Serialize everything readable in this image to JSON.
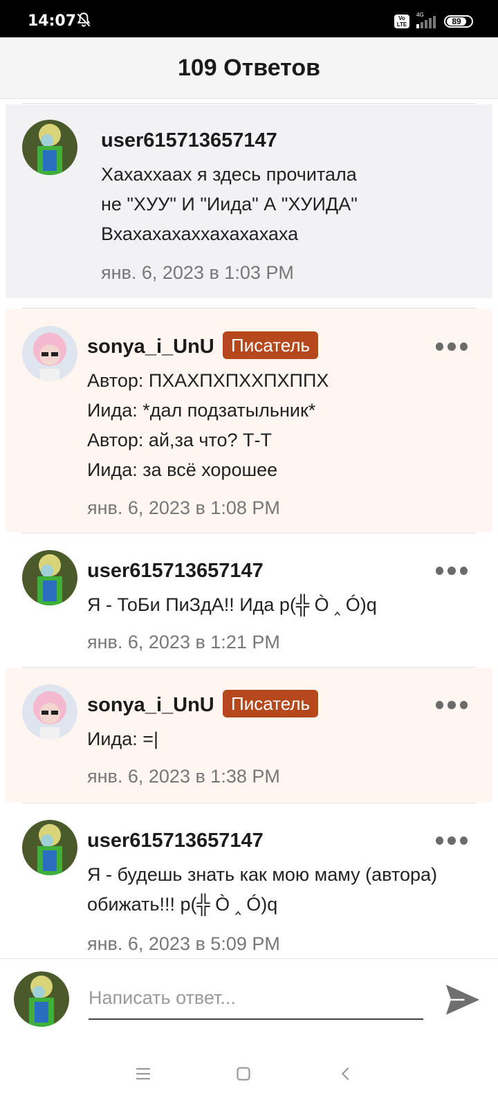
{
  "status_bar": {
    "time": "14:07",
    "bell_icon": "bell-off-icon",
    "volte": "Vo LTE",
    "network": "4G",
    "battery": "89"
  },
  "header": {
    "title": "109 Ответов"
  },
  "comments": [
    {
      "author": "user615713657147",
      "lines": [
        "Хахаххаах я здесь прочитала",
        "не \"ХУУ\" И \"Иида\" А \"ХУИДА\"",
        "Вхахахахаххахахахаха"
      ],
      "timestamp": "янв. 6, 2023 в 1:03 PM"
    },
    {
      "author": "sonya_i_UnU",
      "badge": "Писатель",
      "lines": [
        "Автор: ПХАХПХПХХПХППХ",
        "Иида: *дал подзатыльник*",
        "Автор: ай,за что? Т-Т",
        "Иида: за всё хорошее"
      ],
      "timestamp": "янв. 6, 2023 в 1:08 PM"
    },
    {
      "author": "user615713657147",
      "lines": [
        "Я - ТоБи ПиЗдА!! Ида p(╬ Ò ‸ Ó)q"
      ],
      "timestamp": "янв. 6, 2023 в 1:21 PM"
    },
    {
      "author": "sonya_i_UnU",
      "badge": "Писатель",
      "lines": [
        "Иида: =|"
      ],
      "timestamp": "янв. 6, 2023 в 1:38 PM"
    },
    {
      "author": "user615713657147",
      "lines": [
        "Я - будешь знать как мою маму (автора)",
        "обижать!!! p(╬ Ò ‸ Ó)q"
      ],
      "timestamp": "янв. 6, 2023 в 5:09 PM"
    }
  ],
  "composer": {
    "placeholder": "Написать ответ..."
  },
  "nav": {
    "icons": [
      "menu-icon",
      "home-square-icon",
      "back-icon"
    ]
  }
}
